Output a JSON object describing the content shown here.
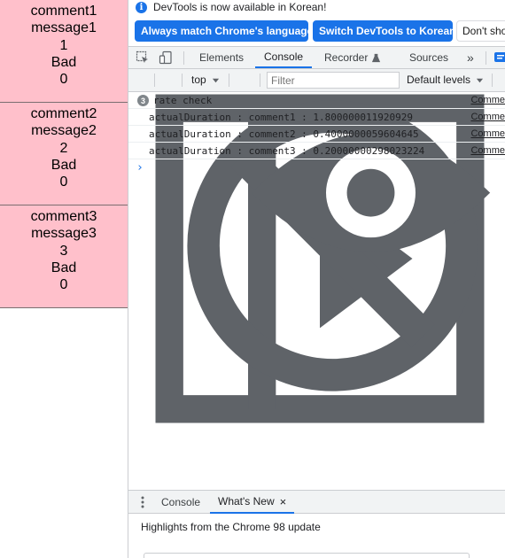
{
  "cards": [
    {
      "comment": "comment1",
      "message": "message1",
      "id": "1",
      "rating": "Bad",
      "count": "0"
    },
    {
      "comment": "comment2",
      "message": "message2",
      "id": "2",
      "rating": "Bad",
      "count": "0"
    },
    {
      "comment": "comment3",
      "message": "message3",
      "id": "3",
      "rating": "Bad",
      "count": "0"
    }
  ],
  "devtools": {
    "infobar": {
      "icon": "i",
      "message": "DevTools is now available in Korean!",
      "btn_match": "Always match Chrome's language",
      "btn_switch": "Switch DevTools to Korean",
      "btn_dont": "Don't sho"
    },
    "tabs": {
      "elements": "Elements",
      "console": "Console",
      "recorder": "Recorder",
      "sources": "Sources",
      "more": "»"
    },
    "toolbar": {
      "context": "top",
      "filter_placeholder": "Filter",
      "levels": "Default levels"
    },
    "console": {
      "group_count": "3",
      "group_label": "rate check",
      "group_src": "Comme",
      "logs": [
        {
          "text": "actualDuration : comment1 : 1.800000011920929",
          "src": "Comme"
        },
        {
          "text": "actualDuration : comment2 : 0.4000000059604645",
          "src": "Comme"
        },
        {
          "text": "actualDuration : comment3 : 0.20000000298023224",
          "src": "Comme"
        }
      ],
      "prompt": "›"
    },
    "drawer": {
      "tab_console": "Console",
      "tab_whatsnew": "What's New",
      "close": "×",
      "headline": "Highlights from the Chrome 98 update"
    }
  },
  "colors": {
    "card_bg": "#ffc0cb",
    "accent": "#1a73e8"
  }
}
